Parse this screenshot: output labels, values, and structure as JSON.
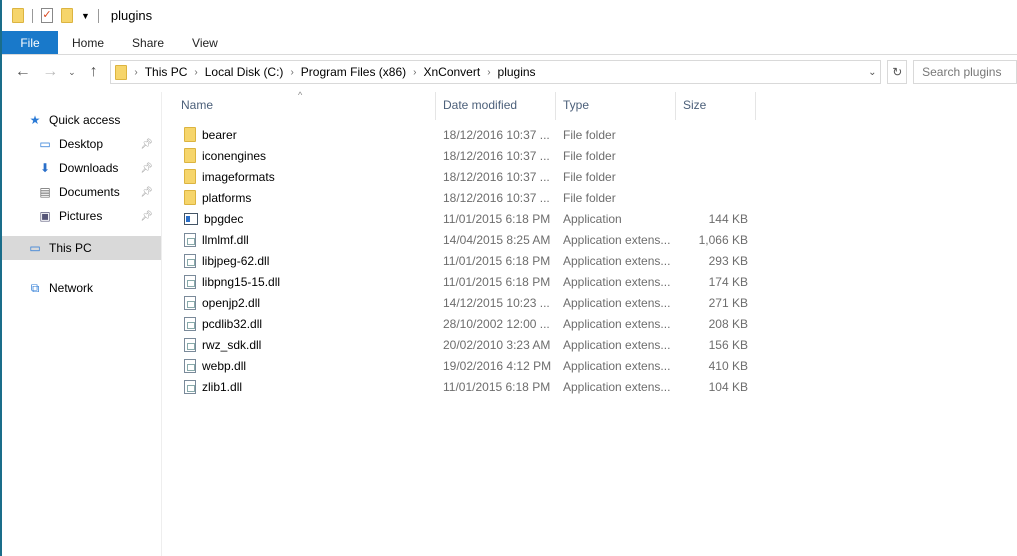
{
  "title": "plugins",
  "ribbon": [
    "File",
    "Home",
    "Share",
    "View"
  ],
  "breadcrumb": [
    "This PC",
    "Local Disk (C:)",
    "Program Files (x86)",
    "XnConvert",
    "plugins"
  ],
  "search_placeholder": "Search plugins",
  "sidebar": [
    {
      "label": "Quick access",
      "icon": "star-icon",
      "indent": 0,
      "pin": false
    },
    {
      "label": "Desktop",
      "icon": "desktop-icon",
      "indent": 1,
      "pin": true
    },
    {
      "label": "Downloads",
      "icon": "download-icon",
      "indent": 1,
      "pin": true
    },
    {
      "label": "Documents",
      "icon": "documents-icon",
      "indent": 1,
      "pin": true
    },
    {
      "label": "Pictures",
      "icon": "pictures-icon",
      "indent": 1,
      "pin": true
    },
    {
      "label": "This PC",
      "icon": "computer-icon",
      "indent": 0,
      "pin": false,
      "selected": true
    },
    {
      "label": "Network",
      "icon": "network-icon",
      "indent": 0,
      "pin": false
    }
  ],
  "columns": [
    "Name",
    "Date modified",
    "Type",
    "Size"
  ],
  "files": [
    {
      "name": "bearer",
      "date": "18/12/2016 10:37 ...",
      "type": "File folder",
      "size": "",
      "kind": "folder"
    },
    {
      "name": "iconengines",
      "date": "18/12/2016 10:37 ...",
      "type": "File folder",
      "size": "",
      "kind": "folder"
    },
    {
      "name": "imageformats",
      "date": "18/12/2016 10:37 ...",
      "type": "File folder",
      "size": "",
      "kind": "folder"
    },
    {
      "name": "platforms",
      "date": "18/12/2016 10:37 ...",
      "type": "File folder",
      "size": "",
      "kind": "folder"
    },
    {
      "name": "bpgdec",
      "date": "11/01/2015 6:18 PM",
      "type": "Application",
      "size": "144 KB",
      "kind": "app"
    },
    {
      "name": "llmlmf.dll",
      "date": "14/04/2015 8:25 AM",
      "type": "Application extens...",
      "size": "1,066 KB",
      "kind": "dll"
    },
    {
      "name": "libjpeg-62.dll",
      "date": "11/01/2015 6:18 PM",
      "type": "Application extens...",
      "size": "293 KB",
      "kind": "dll"
    },
    {
      "name": "libpng15-15.dll",
      "date": "11/01/2015 6:18 PM",
      "type": "Application extens...",
      "size": "174 KB",
      "kind": "dll"
    },
    {
      "name": "openjp2.dll",
      "date": "14/12/2015 10:23 ...",
      "type": "Application extens...",
      "size": "271 KB",
      "kind": "dll"
    },
    {
      "name": "pcdlib32.dll",
      "date": "28/10/2002 12:00 ...",
      "type": "Application extens...",
      "size": "208 KB",
      "kind": "dll"
    },
    {
      "name": "rwz_sdk.dll",
      "date": "20/02/2010 3:23 AM",
      "type": "Application extens...",
      "size": "156 KB",
      "kind": "dll"
    },
    {
      "name": "webp.dll",
      "date": "19/02/2016 4:12 PM",
      "type": "Application extens...",
      "size": "410 KB",
      "kind": "dll"
    },
    {
      "name": "zlib1.dll",
      "date": "11/01/2015 6:18 PM",
      "type": "Application extens...",
      "size": "104 KB",
      "kind": "dll"
    }
  ]
}
